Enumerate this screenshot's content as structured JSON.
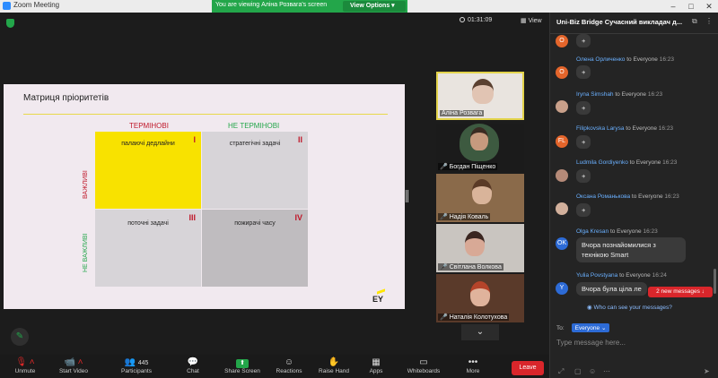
{
  "window": {
    "title": "Zoom Meeting"
  },
  "share_banner": {
    "text": "You are viewing Аліна Розвага's screen",
    "view_options": "View Options"
  },
  "top_bar": {
    "timer": "01:31:09",
    "view_label": "View"
  },
  "slide": {
    "title": "Матриця пріоритетів",
    "col_urgent": "ТЕРМІНОВІ",
    "col_not_urgent": "НЕ ТЕРМІНОВІ",
    "row_important": "ВАЖЛИВІ",
    "row_not_important": "НЕ ВАЖЛИВІ",
    "cells": [
      {
        "label": "палаючі дедлайни",
        "num": "I"
      },
      {
        "label": "стратегічні задачі",
        "num": "II"
      },
      {
        "label": "поточні задачі",
        "num": "III"
      },
      {
        "label": "пожирачі часу",
        "num": "IV"
      }
    ],
    "logo": "EY"
  },
  "participants_tiles": [
    {
      "name": "Аліна Розвага"
    },
    {
      "name": "Богдан Піщенко"
    },
    {
      "name": "Надія Коваль"
    },
    {
      "name": "Світлана Волкова"
    },
    {
      "name": "Наталія Колотухова"
    }
  ],
  "toolbar": {
    "unmute": "Unmute",
    "start_video": "Start Video",
    "participants": "Participants",
    "participants_count": "445",
    "chat": "Chat",
    "share_screen": "Share Screen",
    "reactions": "Reactions",
    "raise_hand": "Raise Hand",
    "apps": "Apps",
    "whiteboards": "Whiteboards",
    "more": "More",
    "leave": "Leave"
  },
  "chat": {
    "title": "Uni-Biz Bridge Сучасний викладач д...",
    "messages": [
      {
        "avatar": "O",
        "name": "",
        "to": "",
        "time": "",
        "text": "+"
      },
      {
        "avatar": "O",
        "name": "Олена Орличенко",
        "to": "to Everyone",
        "time": "16:23",
        "text": "+"
      },
      {
        "avatar": "",
        "name": "Iryna Simshah",
        "to": "to Everyone",
        "time": "16:23",
        "text": "+"
      },
      {
        "avatar": "FL",
        "name": "Filipkovska Larysa",
        "to": "to Everyone",
        "time": "16:23",
        "text": "+"
      },
      {
        "avatar": "",
        "name": "Ludmila Gordiyenko",
        "to": "to Everyone",
        "time": "16:23",
        "text": "+"
      },
      {
        "avatar": "",
        "name": "Оксана Романькова",
        "to": "to Everyone",
        "time": "16:23",
        "text": "+"
      },
      {
        "avatar": "OK",
        "name": "Olga Kresan",
        "to": "to Everyone",
        "time": "16:23",
        "text": "Вчора познайомилися з технікою Smart"
      },
      {
        "avatar": "Y",
        "name": "Yulia Povstyana",
        "to": "to Everyone",
        "time": "16:24",
        "text": "Вчора була ціла ле"
      }
    ],
    "new_messages": "2 new messages",
    "who_can_see": "Who can see your messages?",
    "to_label": "To:",
    "to_value": "Everyone",
    "input_placeholder": "Type message here..."
  },
  "colors": {
    "accent_green": "#23a64a",
    "leave_red": "#d9262b",
    "slide_yellow": "#f8e200",
    "link_blue": "#6ab0ff"
  }
}
